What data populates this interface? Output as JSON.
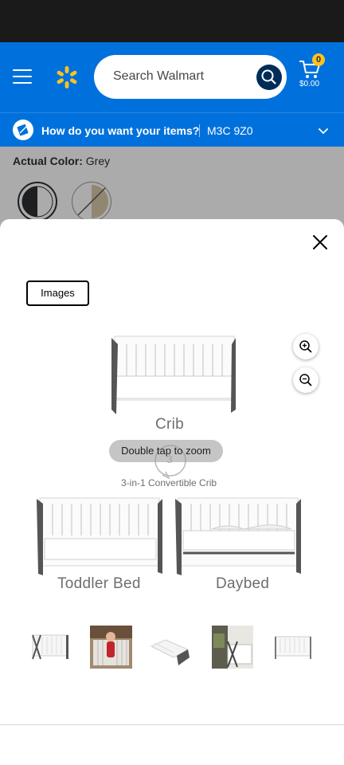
{
  "header": {
    "search_placeholder": "Search Walmart",
    "cart_count": "0",
    "cart_total": "$0.00"
  },
  "delivery": {
    "question": "How do you want your items?",
    "postal_code": "M3C 9Z0"
  },
  "product": {
    "actual_color_label": "Actual Color:",
    "actual_color_value": "Grey",
    "swatches": [
      "grey",
      "natural"
    ]
  },
  "gallery": {
    "tab_images": "Images",
    "zoom_hint": "Double tap to zoom",
    "captions": {
      "crib": "Crib",
      "convertible": "3-in-1 Convertible Crib",
      "toddler": "Toddler Bed",
      "daybed": "Daybed",
      "step_number": "3"
    },
    "thumbnail_count": 5
  },
  "colors": {
    "walmart_blue": "#0071dc",
    "spark_yellow": "#ffc220",
    "search_button": "#002d58"
  },
  "icons": [
    "menu-icon",
    "spark-logo-icon",
    "search-icon",
    "cart-icon",
    "delivery-icon",
    "chevron-down-icon",
    "close-icon",
    "zoom-in-icon",
    "zoom-out-icon"
  ]
}
